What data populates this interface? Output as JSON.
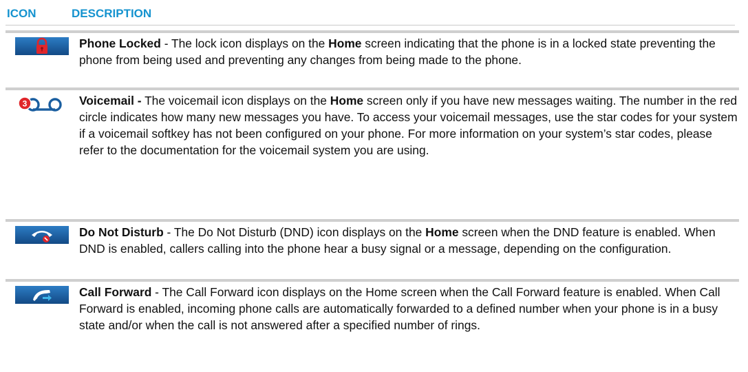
{
  "header": {
    "icon_col": "ICON",
    "desc_col": "DESCRIPTION"
  },
  "rows": [
    {
      "icon": "lock-icon",
      "title": "Phone Locked",
      "sep": " - ",
      "t1": "The lock icon displays on the ",
      "b1": "Home",
      "t2": " screen indicating that the phone is in a locked state preventing the phone from being used and preventing any changes from being made to the phone."
    },
    {
      "icon": "voicemail-icon",
      "badge": "3",
      "title": "Voicemail -",
      "sep": " ",
      "t1": "The voicemail icon displays on the ",
      "b1": "Home",
      "t2": " screen only if you have new messages waiting. The number in the red circle indicates how many new messages you have. To access your voicemail messages, use the star codes for your system if a voicemail softkey has not been configured on your phone. For more information on your system’s star codes, please refer to the documentation for the voicemail system you are using."
    },
    {
      "icon": "do-not-disturb-icon",
      "title": "Do Not Disturb",
      "sep": " - ",
      "t1": "The Do Not Disturb (DND) icon displays on the ",
      "b1": "Home",
      "t2": " screen when the DND feature is enabled. When DND is enabled, callers calling into the phone hear a busy signal or a message, depending on the configuration."
    },
    {
      "icon": "call-forward-icon",
      "title": "Call Forward",
      "sep": " - ",
      "t1": "The Call Forward icon displays on the Home screen when the Call Forward feature is enabled. When Call Forward is enabled, incoming phone calls are automatically forwarded to a defined number when your phone is in a busy state and/or when the call is not answered after a specified number of rings."
    }
  ],
  "colors": {
    "header": "#1593cf",
    "icon_bg": "#1a5ea0",
    "accent_red": "#e0262b"
  }
}
